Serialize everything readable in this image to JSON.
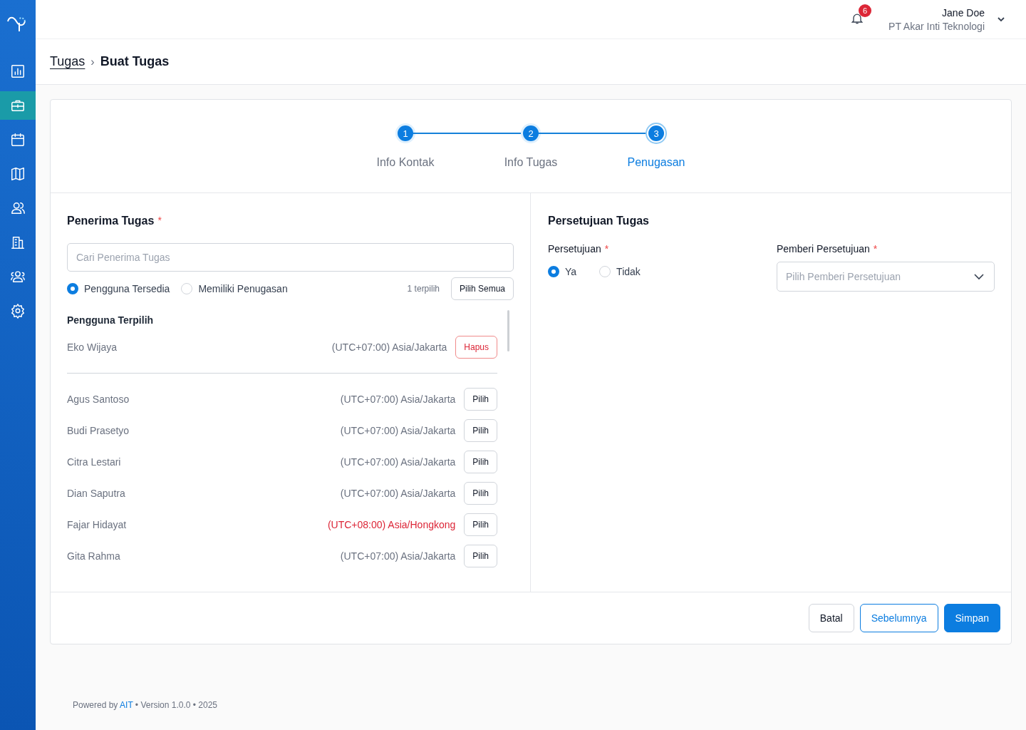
{
  "sidebar": {
    "items": [
      {
        "selected": false
      },
      {
        "selected": true
      },
      {
        "selected": false
      },
      {
        "selected": false
      },
      {
        "selected": false
      },
      {
        "selected": false
      },
      {
        "selected": false
      },
      {
        "selected": false
      }
    ]
  },
  "header": {
    "notification_count": "6",
    "user_name": "Jane Doe",
    "company": "PT Akar Inti Teknologi"
  },
  "breadcrumb": {
    "parent": "Tugas",
    "separator": "›",
    "current": "Buat Tugas"
  },
  "stepper": {
    "steps": [
      {
        "number": "1",
        "label": "Info Kontak",
        "selected": false
      },
      {
        "number": "2",
        "label": "Info Tugas",
        "selected": false
      },
      {
        "number": "3",
        "label": "Penugasan",
        "selected": true
      }
    ]
  },
  "assignees": {
    "title": "Penerima Tugas",
    "required_mark": "*",
    "search": {
      "placeholder": "Cari Penerima Tugas"
    },
    "filters": [
      {
        "label": "Pengguna Tersedia",
        "selected": true
      },
      {
        "label": "Memiliki Penugasan",
        "selected": false
      }
    ],
    "selected_count": "1 terpilih",
    "select_all": "Pilih Semua",
    "selected_heading": "Pengguna Terpilih",
    "selected_users": [
      {
        "name": "Eko Wijaya",
        "timezone": "(UTC+07:00) Asia/Jakarta",
        "mismatch": false,
        "action": "Hapus",
        "kind": "remove"
      }
    ],
    "available_users": [
      {
        "name": "Agus Santoso",
        "timezone": "(UTC+07:00) Asia/Jakarta",
        "mismatch": false,
        "action": "Pilih",
        "kind": "add"
      },
      {
        "name": "Budi Prasetyo",
        "timezone": "(UTC+07:00) Asia/Jakarta",
        "mismatch": false,
        "action": "Pilih",
        "kind": "add"
      },
      {
        "name": "Citra Lestari",
        "timezone": "(UTC+07:00) Asia/Jakarta",
        "mismatch": false,
        "action": "Pilih",
        "kind": "add"
      },
      {
        "name": "Dian Saputra",
        "timezone": "(UTC+07:00) Asia/Jakarta",
        "mismatch": false,
        "action": "Pilih",
        "kind": "add"
      },
      {
        "name": "Fajar Hidayat",
        "timezone": "(UTC+08:00) Asia/Hongkong",
        "mismatch": true,
        "action": "Pilih",
        "kind": "add"
      },
      {
        "name": "Gita Rahma",
        "timezone": "(UTC+07:00) Asia/Jakarta",
        "mismatch": false,
        "action": "Pilih",
        "kind": "add"
      }
    ]
  },
  "approval": {
    "title": "Persetujuan Tugas",
    "approval_field": {
      "label": "Persetujuan",
      "required_mark": "*",
      "options": [
        {
          "label": "Ya",
          "selected": true
        },
        {
          "label": "Tidak",
          "selected": false
        }
      ]
    },
    "approver_field": {
      "label": "Pemberi Persetujuan",
      "required_mark": "*",
      "placeholder": "Pilih Pemberi Persetujuan"
    }
  },
  "actions": [
    {
      "label": "Batal",
      "kind": "secondary"
    },
    {
      "label": "Sebelumnya",
      "kind": "outline"
    },
    {
      "label": "Simpan",
      "kind": "primary"
    }
  ],
  "footer": {
    "prefix": "Powered by",
    "link": "AIT",
    "suffix": "• Version 1.0.0 • 2025"
  }
}
